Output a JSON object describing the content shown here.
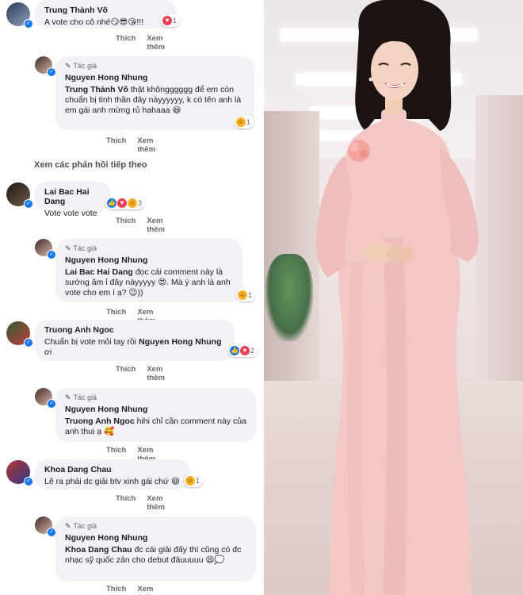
{
  "thread": {
    "author_label": "Tác giả",
    "more_replies": "Xem các phản hồi tiếp theo",
    "comments": [
      {
        "name": "Trung Thành Võ",
        "text": "A vote cho cô nhé😏😎😘!!!",
        "reaction_count": "1",
        "like": "Thích",
        "reply": "Xem thêm"
      },
      {
        "is_author": true,
        "name": "Nguyen Hong Nhung",
        "mention": "Trung Thành Võ",
        "text": "thật khôngggggg để em còn chuẩn bị tinh thần đây nàyyyyyy, k có tên anh là em gái anh mừng rủ hahaaa 😆",
        "reaction_count": "1",
        "like": "Thích",
        "reply": "Xem thêm"
      },
      {
        "name": "Lai Bac Hai Dang",
        "text": "Vote vote vote",
        "reaction_count": "3",
        "like": "Thích",
        "reply": "Xem thêm"
      },
      {
        "is_author": true,
        "name": "Nguyen Hong Nhung",
        "mention": "Lai Bac Hai Dang",
        "text": "đọc cái comment này là sướng âm ỉ đây nàyyyyy 😍. Mà ý anh là anh vote cho em í ạ? 😉))",
        "reaction_count": "1",
        "like": "Thích",
        "reply": "Xem thêm"
      },
      {
        "name": "Truong Anh Ngoc",
        "text_pre": "Chuẩn bị vote mỏi tay rồi",
        "mention": "Nguyen Hong Nhung",
        "text_post": "ơi",
        "reaction_count": "2",
        "like": "Thích",
        "reply": "Xem thêm"
      },
      {
        "is_author": true,
        "name": "Nguyen Hong Nhung",
        "mention": "Truong Anh Ngoc",
        "text": "hihi chỉ cần comment này của anh thui ạ 🥰",
        "like": "Thích",
        "reply": "Xem thêm"
      },
      {
        "name": "Khoa Dang Chau",
        "text": "Lẽ ra phải dc giải btv xinh gái chứ 😆",
        "reaction_count": "1",
        "like": "Thích",
        "reply": "Xem thêm"
      },
      {
        "is_author": true,
        "name": "Nguyen Hong Nhung",
        "mention": "Khoa Dang Chau",
        "text": "đc cái giải đấy thì cũng có đc nhạc sỹ quốc zản cho debut đâuuuuu 😫💭",
        "like": "Thích",
        "reply": "Xem thêm"
      }
    ]
  },
  "colors": {
    "bubble": "#f0f2f5",
    "meta_text": "#65676b",
    "like_blue": "#1877f2",
    "love_red": "#f33e58",
    "haha_yellow": "#f7b125",
    "ao_dai_pink": "#f2c7c5"
  },
  "icons": {
    "reaction_like": "like-icon",
    "reaction_love": "heart-icon",
    "reaction_haha": "haha-icon",
    "author_tag": "pencil-icon"
  }
}
